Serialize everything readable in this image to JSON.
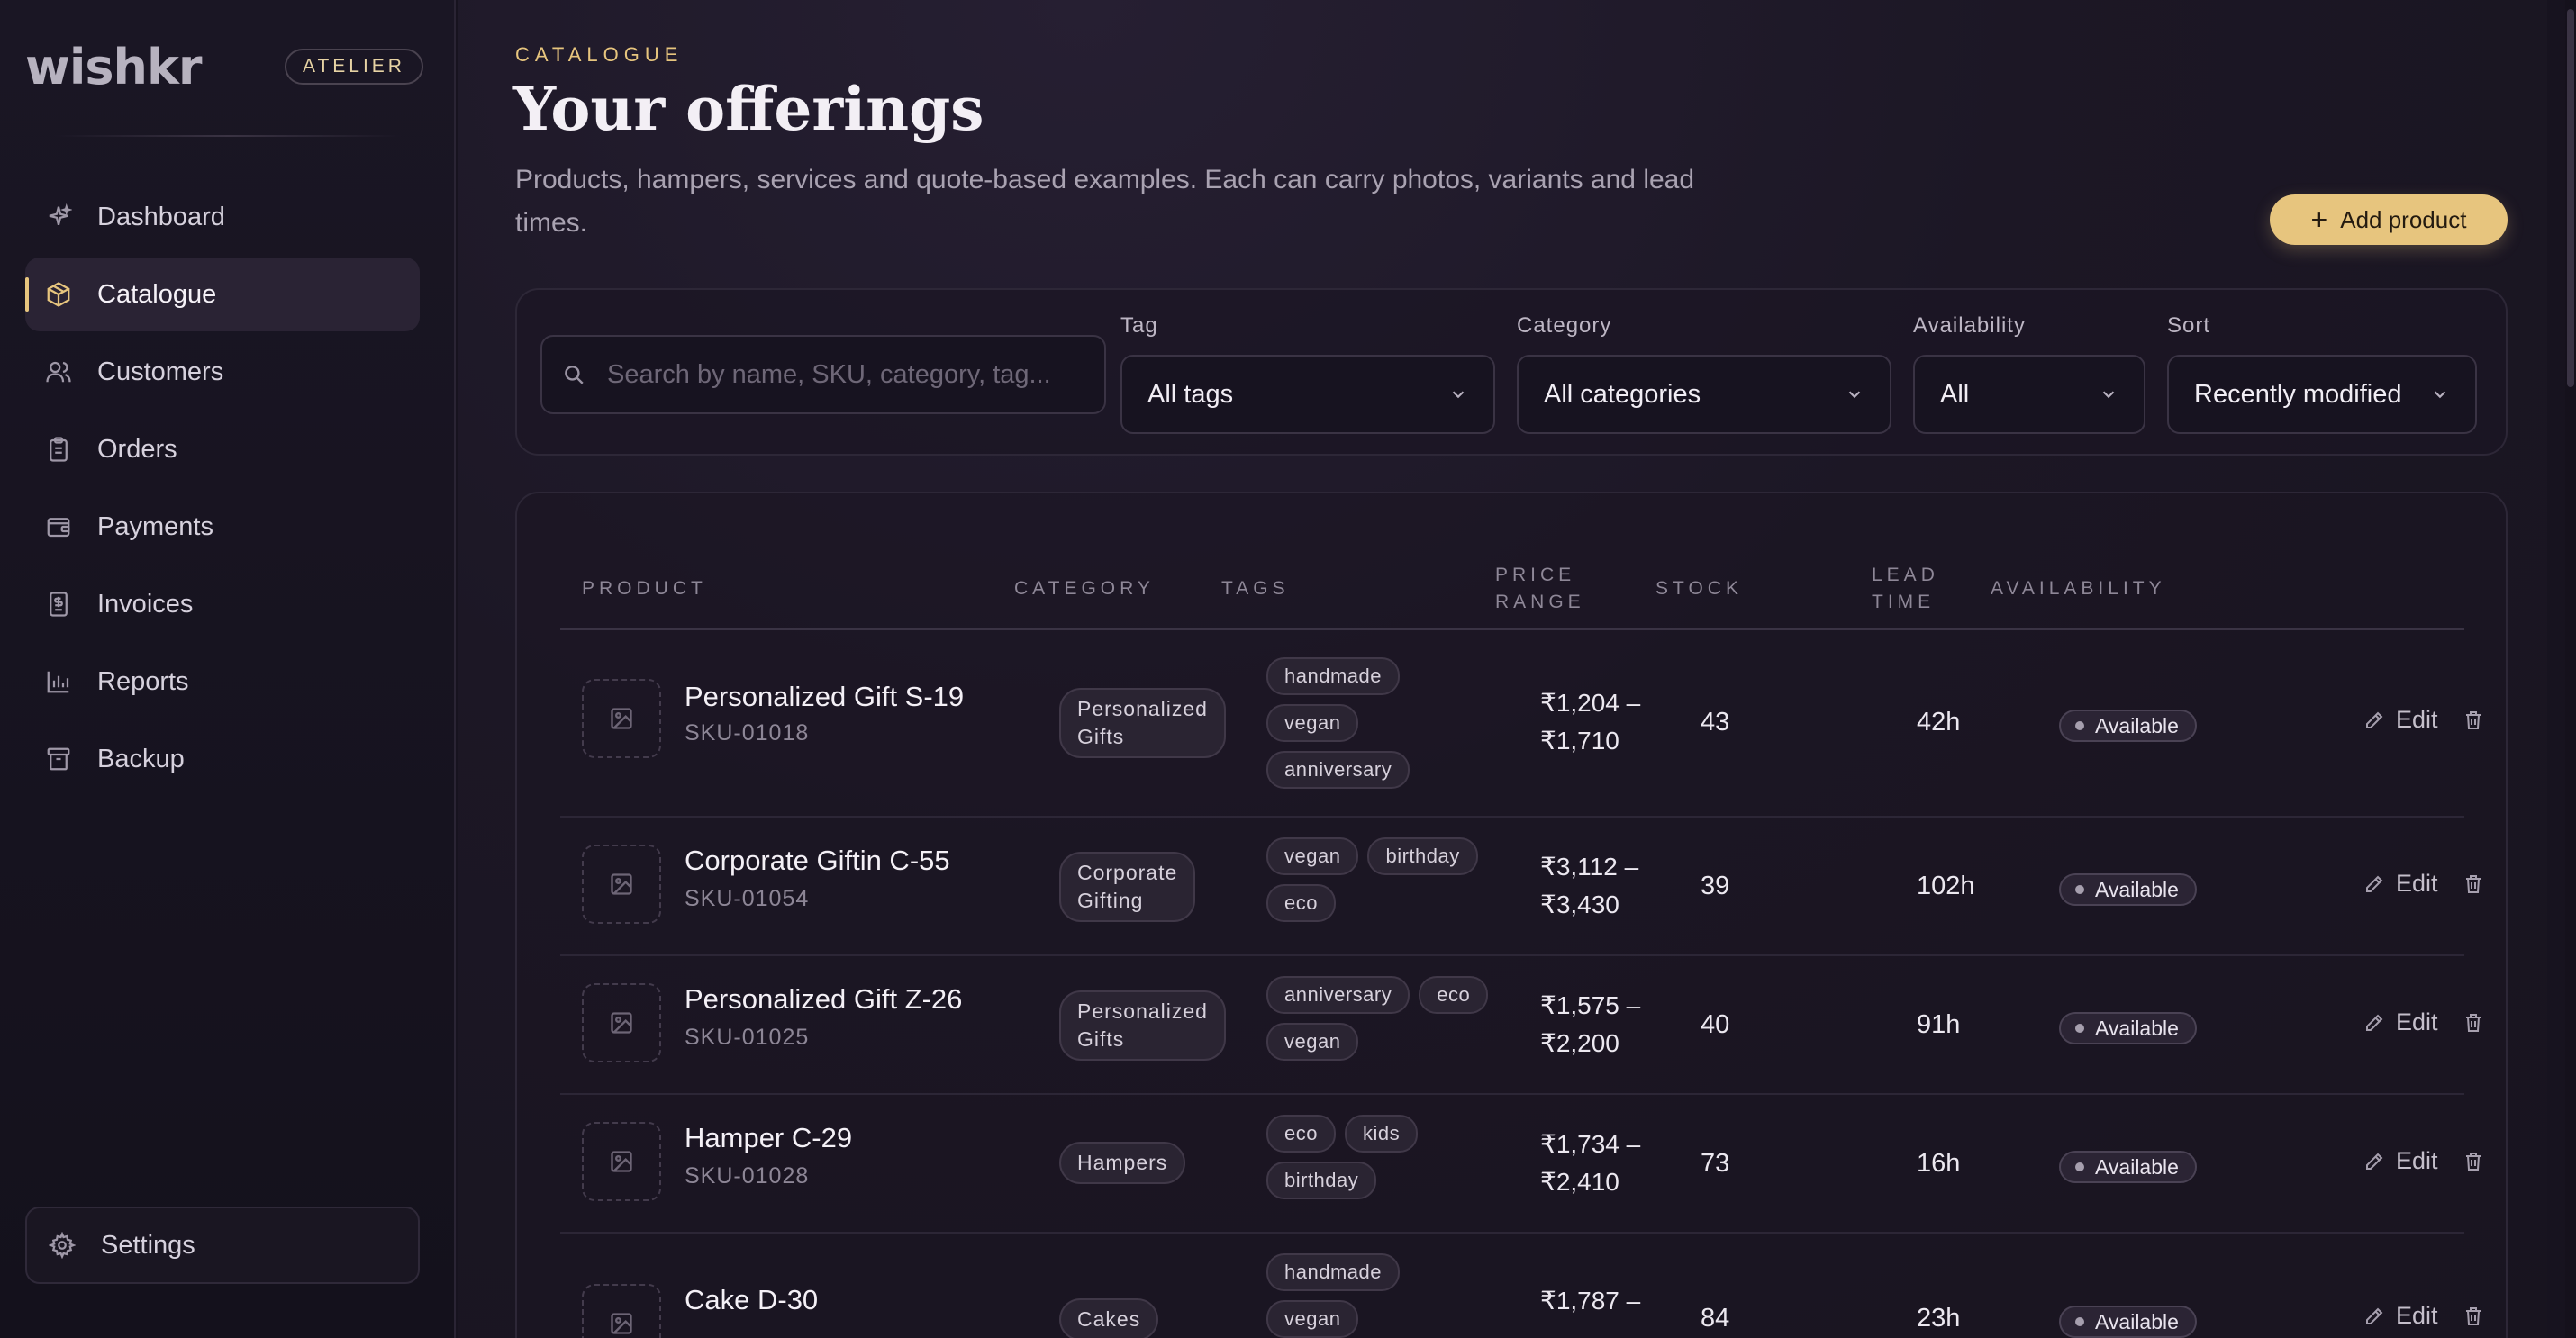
{
  "brand": {
    "logo": "wishkr",
    "badge": "ATELIER"
  },
  "nav": {
    "items": [
      {
        "label": "Dashboard",
        "icon": "sparkle-icon",
        "active": false
      },
      {
        "label": "Catalogue",
        "icon": "box-icon",
        "active": true
      },
      {
        "label": "Customers",
        "icon": "users-icon",
        "active": false
      },
      {
        "label": "Orders",
        "icon": "clipboard-icon",
        "active": false
      },
      {
        "label": "Payments",
        "icon": "wallet-icon",
        "active": false
      },
      {
        "label": "Invoices",
        "icon": "invoice-icon",
        "active": false
      },
      {
        "label": "Reports",
        "icon": "bar-chart-icon",
        "active": false
      },
      {
        "label": "Backup",
        "icon": "archive-icon",
        "active": false
      }
    ],
    "settings": "Settings"
  },
  "header": {
    "eyebrow": "CATALOGUE",
    "title": "Your offerings",
    "description": "Products, hampers, services and quote-based examples. Each can carry photos, variants and lead times.",
    "add_button": "Add product"
  },
  "filters": {
    "search_placeholder": "Search by name, SKU, category, tag...",
    "tag": {
      "label": "Tag",
      "value": "All tags"
    },
    "category": {
      "label": "Category",
      "value": "All categories"
    },
    "availability": {
      "label": "Availability",
      "value": "All"
    },
    "sort": {
      "label": "Sort",
      "value": "Recently modified"
    }
  },
  "table": {
    "columns": {
      "product": "PRODUCT",
      "category": "CATEGORY",
      "tags": "TAGS",
      "price_l1": "PRICE",
      "price_l2": "RANGE",
      "stock": "STOCK",
      "lead_l1": "LEAD",
      "lead_l2": "TIME",
      "availability": "AVAILABILITY"
    },
    "edit_label": "Edit",
    "rows": [
      {
        "name": "Personalized Gift S-19",
        "sku": "SKU-01018",
        "category_l1": "Personalized",
        "category_l2": "Gifts",
        "tags": [
          "handmade",
          "vegan",
          "anniversary"
        ],
        "price_min": "₹1,204 –",
        "price_max": "₹1,710",
        "stock": "43",
        "lead": "42h",
        "availability": "Available"
      },
      {
        "name": "Corporate Giftin C-55",
        "sku": "SKU-01054",
        "category_l1": "Corporate",
        "category_l2": "Gifting",
        "tags": [
          "vegan",
          "birthday",
          "eco"
        ],
        "price_min": "₹3,112 –",
        "price_max": "₹3,430",
        "stock": "39",
        "lead": "102h",
        "availability": "Available"
      },
      {
        "name": "Personalized Gift Z-26",
        "sku": "SKU-01025",
        "category_l1": "Personalized",
        "category_l2": "Gifts",
        "tags": [
          "anniversary",
          "eco",
          "vegan"
        ],
        "price_min": "₹1,575 –",
        "price_max": "₹2,200",
        "stock": "40",
        "lead": "91h",
        "availability": "Available"
      },
      {
        "name": "Hamper C-29",
        "sku": "SKU-01028",
        "category_l1": "Hampers",
        "category_l2": "",
        "tags": [
          "eco",
          "kids",
          "birthday"
        ],
        "price_min": "₹1,734 –",
        "price_max": "₹2,410",
        "stock": "73",
        "lead": "16h",
        "availability": "Available"
      },
      {
        "name": "Cake D-30",
        "sku": "",
        "category_l1": "Cakes",
        "category_l2": "",
        "tags": [
          "handmade",
          "vegan"
        ],
        "price_min": "₹1,787 –",
        "price_max": "",
        "stock": "84",
        "lead": "23h",
        "availability": "Available"
      }
    ]
  },
  "colors": {
    "accent": "#e7c57e",
    "background": "#17131f"
  }
}
